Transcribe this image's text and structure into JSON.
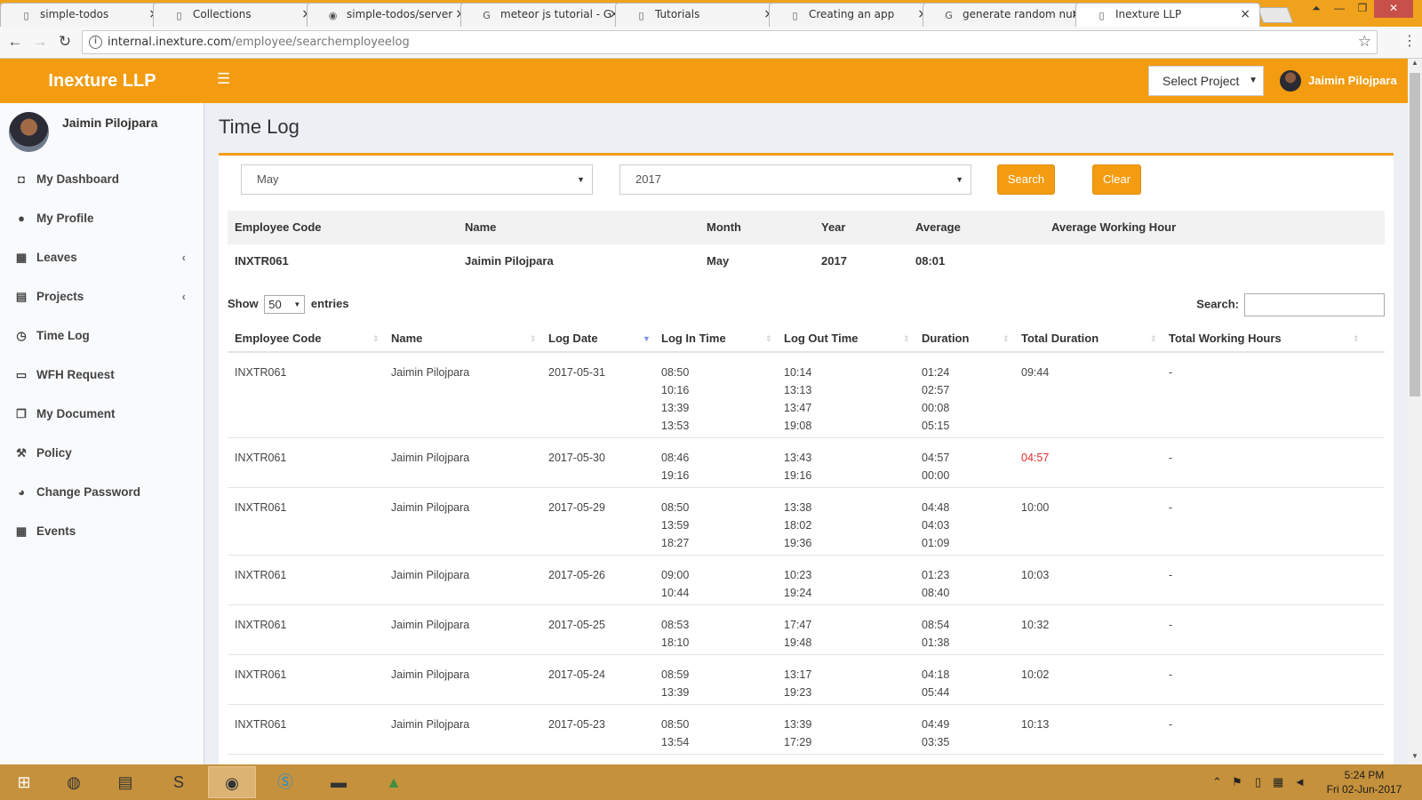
{
  "browser": {
    "tabs": [
      {
        "title": "simple-todos",
        "icon": "page-icon"
      },
      {
        "title": "Collections",
        "icon": "page-icon"
      },
      {
        "title": "simple-todos/server",
        "icon": "github-icon"
      },
      {
        "title": "meteor js tutorial - G",
        "icon": "google-icon"
      },
      {
        "title": "Tutorials",
        "icon": "page-icon"
      },
      {
        "title": "Creating an app",
        "icon": "page-icon"
      },
      {
        "title": "generate random nur",
        "icon": "google-icon"
      },
      {
        "title": "Inexture LLP",
        "icon": "page-icon"
      }
    ],
    "url_host": "internal.inexture.com",
    "url_path": "/employee/searchemployeelog"
  },
  "header": {
    "brand": "Inexture LLP",
    "project_select": "Select Project",
    "user_name": "Jaimin Pilojpara"
  },
  "sidebar": {
    "user_name": "Jaimin Pilojpara",
    "items": [
      {
        "label": "My Dashboard",
        "icon": "dashboard-icon",
        "glyph": "◘"
      },
      {
        "label": "My Profile",
        "icon": "user-icon",
        "glyph": "●"
      },
      {
        "label": "Leaves",
        "icon": "calendar-check-icon",
        "glyph": "▦",
        "arrow": "‹"
      },
      {
        "label": "Projects",
        "icon": "file-icon",
        "glyph": "▤",
        "arrow": "‹"
      },
      {
        "label": "Time Log",
        "icon": "clock-icon",
        "glyph": "◷"
      },
      {
        "label": "WFH Request",
        "icon": "laptop-icon",
        "glyph": "▭"
      },
      {
        "label": "My Document",
        "icon": "documents-icon",
        "glyph": "❐"
      },
      {
        "label": "Policy",
        "icon": "gavel-icon",
        "glyph": "⚒"
      },
      {
        "label": "Change Password",
        "icon": "dashboard-gauge-icon",
        "glyph": "◕"
      },
      {
        "label": "Events",
        "icon": "calendar-icon",
        "glyph": "▦"
      }
    ]
  },
  "page": {
    "title": "Time Log",
    "filters": {
      "month": "May",
      "year": "2017"
    },
    "search_button": "Search",
    "clear_button": "Clear",
    "summary": {
      "headers": [
        "Employee Code",
        "Name",
        "Month",
        "Year",
        "Average",
        "Average Working Hour"
      ],
      "values": [
        "INXTR061",
        "Jaimin Pilojpara",
        "May",
        "2017",
        "08:01",
        ""
      ]
    },
    "show_label": "Show",
    "entries_value": "50",
    "entries_label": "entries",
    "search_label": "Search:",
    "columns": [
      "Employee Code",
      "Name",
      "Log Date",
      "Log In Time",
      "Log Out Time",
      "Duration",
      "Total Duration",
      "Total Working Hours"
    ],
    "rows": [
      {
        "code": "INXTR061",
        "name": "Jaimin Pilojpara",
        "date": "2017-05-31",
        "in": "08:50\n10:16\n13:39\n13:53",
        "out": "10:14\n13:13\n13:47\n19:08",
        "duration": "01:24\n02:57\n00:08\n05:15",
        "total": "09:44",
        "total_red": false,
        "working": "-"
      },
      {
        "code": "INXTR061",
        "name": "Jaimin Pilojpara",
        "date": "2017-05-30",
        "in": "08:46\n19:16",
        "out": "13:43\n19:16",
        "duration": "04:57\n00:00",
        "total": "04:57",
        "total_red": true,
        "working": "-"
      },
      {
        "code": "INXTR061",
        "name": "Jaimin Pilojpara",
        "date": "2017-05-29",
        "in": "08:50\n13:59\n18:27",
        "out": "13:38\n18:02\n19:36",
        "duration": "04:48\n04:03\n01:09",
        "total": "10:00",
        "total_red": false,
        "working": "-"
      },
      {
        "code": "INXTR061",
        "name": "Jaimin Pilojpara",
        "date": "2017-05-26",
        "in": "09:00\n10:44",
        "out": "10:23\n19:24",
        "duration": "01:23\n08:40",
        "total": "10:03",
        "total_red": false,
        "working": "-"
      },
      {
        "code": "INXTR061",
        "name": "Jaimin Pilojpara",
        "date": "2017-05-25",
        "in": "08:53\n18:10",
        "out": "17:47\n19:48",
        "duration": "08:54\n01:38",
        "total": "10:32",
        "total_red": false,
        "working": "-"
      },
      {
        "code": "INXTR061",
        "name": "Jaimin Pilojpara",
        "date": "2017-05-24",
        "in": "08:59\n13:39",
        "out": "13:17\n19:23",
        "duration": "04:18\n05:44",
        "total": "10:02",
        "total_red": false,
        "working": "-"
      },
      {
        "code": "INXTR061",
        "name": "Jaimin Pilojpara",
        "date": "2017-05-23",
        "in": "08:50\n13:54",
        "out": "13:39\n17:29",
        "duration": "04:49\n03:35",
        "total": "10:13",
        "total_red": false,
        "working": "-"
      }
    ]
  },
  "taskbar": {
    "clock_time": "5:24 PM",
    "clock_date": "Fri 02-Jun-2017"
  },
  "colors": {
    "accent": "#f39c12",
    "sidebar_bg": "#f9fafc",
    "content_bg": "#ecf0f5",
    "alert_red": "#e02d2d"
  }
}
